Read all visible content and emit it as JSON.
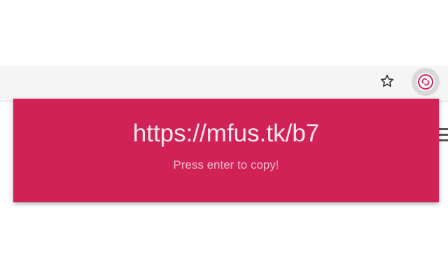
{
  "toolbar": {
    "bookmark_icon": "star-outline-icon",
    "extension_icon": "link-circle-icon"
  },
  "popup": {
    "short_url": "https://mfus.tk/b7",
    "hint": "Press enter to copy!"
  },
  "colors": {
    "accent": "#d12257",
    "toolbar_bg": "#f5f5f5",
    "extension_button_bg": "#d9d9d9"
  }
}
